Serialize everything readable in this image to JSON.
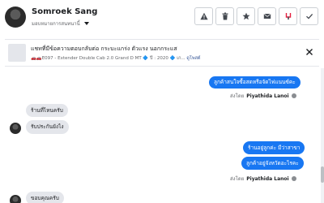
{
  "header": {
    "name": "Somroek Sang",
    "subtitle": "มอบหมายการสนทนานี้"
  },
  "actions": [
    {
      "icon": "warning-icon",
      "name": "report-button"
    },
    {
      "icon": "trash-icon",
      "name": "delete-button"
    },
    {
      "icon": "star-icon",
      "name": "star-button"
    },
    {
      "icon": "envelope-icon",
      "name": "mark-unread-button"
    },
    {
      "icon": "follow-up-icon",
      "name": "follow-up-button"
    },
    {
      "icon": "checkmark-icon",
      "name": "mark-done-button"
    }
  ],
  "post": {
    "title": "แชทที่มีข้อความตอบกลับต่อ กระบะแกร่ง ตัวแรง นอกกระแส",
    "meta": "🚗🚗E097 - Extender Double Cab 2.0 Grand D MT 🔷 ปี : 2020 🔷 เก...",
    "link": "ดูโพสต์"
  },
  "messages": [
    {
      "text": "ลูกค้าสนใจซื้อสดหรือจัดไฟแนนซ์คะ",
      "sent_by_label": "ส่งโดย",
      "sender": "Piyathida Lanoi"
    },
    {
      "text": "ร้านที่ไหนครับ"
    },
    {
      "text": "รับประกันยังไง"
    },
    {
      "text": "ร้านอยู่ลูกค่ะ มีว่าสาขา"
    },
    {
      "text": "ลูกค้าอยู่จังหวัดอะไรคะ",
      "sent_by_label": "ส่งโดย",
      "sender": "Piyathida Lanoi"
    },
    {
      "text": "ขอบคุณครับ"
    }
  ]
}
